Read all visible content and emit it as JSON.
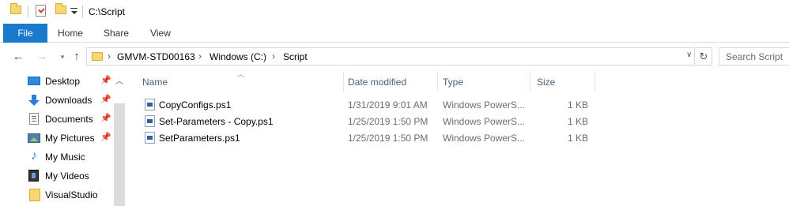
{
  "window": {
    "title_path": "C:\\Script"
  },
  "quick_access_toolbar": {
    "icons": [
      "folder-icon",
      "properties-icon",
      "new-folder-icon",
      "customize-dropdown-icon"
    ]
  },
  "ribbon": {
    "tabs": [
      {
        "label": "File",
        "active": true
      },
      {
        "label": "Home"
      },
      {
        "label": "Share"
      },
      {
        "label": "View"
      }
    ],
    "accent_color": "#1979ca"
  },
  "address_bar": {
    "segments": [
      "GMVM-STD00163",
      "Windows (C:)",
      "Script"
    ]
  },
  "search": {
    "placeholder": "Search Script"
  },
  "nav_pane": {
    "items": [
      {
        "label": "Desktop",
        "icon": "desktop-icon",
        "pinned": true
      },
      {
        "label": "Downloads",
        "icon": "downloads-icon",
        "pinned": true
      },
      {
        "label": "Documents",
        "icon": "documents-icon",
        "pinned": true
      },
      {
        "label": "My Pictures",
        "icon": "pictures-icon",
        "pinned": true
      },
      {
        "label": "My Music",
        "icon": "music-icon",
        "pinned": false
      },
      {
        "label": "My Videos",
        "icon": "videos-icon",
        "pinned": false
      },
      {
        "label": "VisualStudio",
        "icon": "folder-icon",
        "pinned": false
      }
    ]
  },
  "file_list": {
    "columns": [
      "Name",
      "Date modified",
      "Type",
      "Size"
    ],
    "rows": [
      {
        "name": "CopyConfigs.ps1",
        "date": "1/31/2019 9:01 AM",
        "type": "Windows PowerS...",
        "size": "1 KB"
      },
      {
        "name": "Set-Parameters - Copy.ps1",
        "date": "1/25/2019 1:50 PM",
        "type": "Windows PowerS...",
        "size": "1 KB"
      },
      {
        "name": "SetParameters.ps1",
        "date": "1/25/2019 1:50 PM",
        "type": "Windows PowerS...",
        "size": "1 KB"
      }
    ]
  }
}
